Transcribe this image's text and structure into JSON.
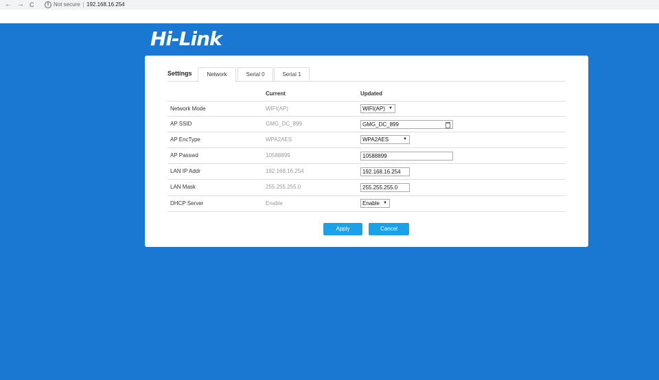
{
  "browser": {
    "back_icon": "←",
    "forward_icon": "→",
    "reload_icon": "C",
    "security_text": "Not secure",
    "url": "192.168.16.254"
  },
  "logo": {
    "text": "Hi-Link"
  },
  "tabs": {
    "label": "Settings",
    "items": [
      {
        "label": "Network",
        "active": true
      },
      {
        "label": "Serial 0",
        "active": false
      },
      {
        "label": "Serial 1",
        "active": false
      }
    ]
  },
  "table": {
    "headers": {
      "current": "Current",
      "updated": "Updated"
    },
    "rows": [
      {
        "label": "Network Mode",
        "current": "WIFI(AP)",
        "updated": "WIFI(AP)",
        "control": "select"
      },
      {
        "label": "AP SSID",
        "current": "GMG_DC_899",
        "updated": "GMG_DC_899",
        "control": "input"
      },
      {
        "label": "AP EncType",
        "current": "WPA2AES",
        "updated": "WPA2AES",
        "control": "select"
      },
      {
        "label": "AP Passwd",
        "current": "10588899",
        "updated": "10588899",
        "control": "input"
      },
      {
        "label": "LAN IP Addr",
        "current": "192.168.16.254",
        "updated": "192.168.16.254",
        "control": "input"
      },
      {
        "label": "LAN Mask",
        "current": "255.255.255.0",
        "updated": "255.255.255.0",
        "control": "input"
      },
      {
        "label": "DHCP Server",
        "current": "Enable",
        "updated": "Enable",
        "control": "select"
      }
    ]
  },
  "actions": {
    "apply": "Apply",
    "cancel": "Cancel"
  },
  "colors": {
    "background": "#1a78d2",
    "button": "#1aa1e8"
  }
}
